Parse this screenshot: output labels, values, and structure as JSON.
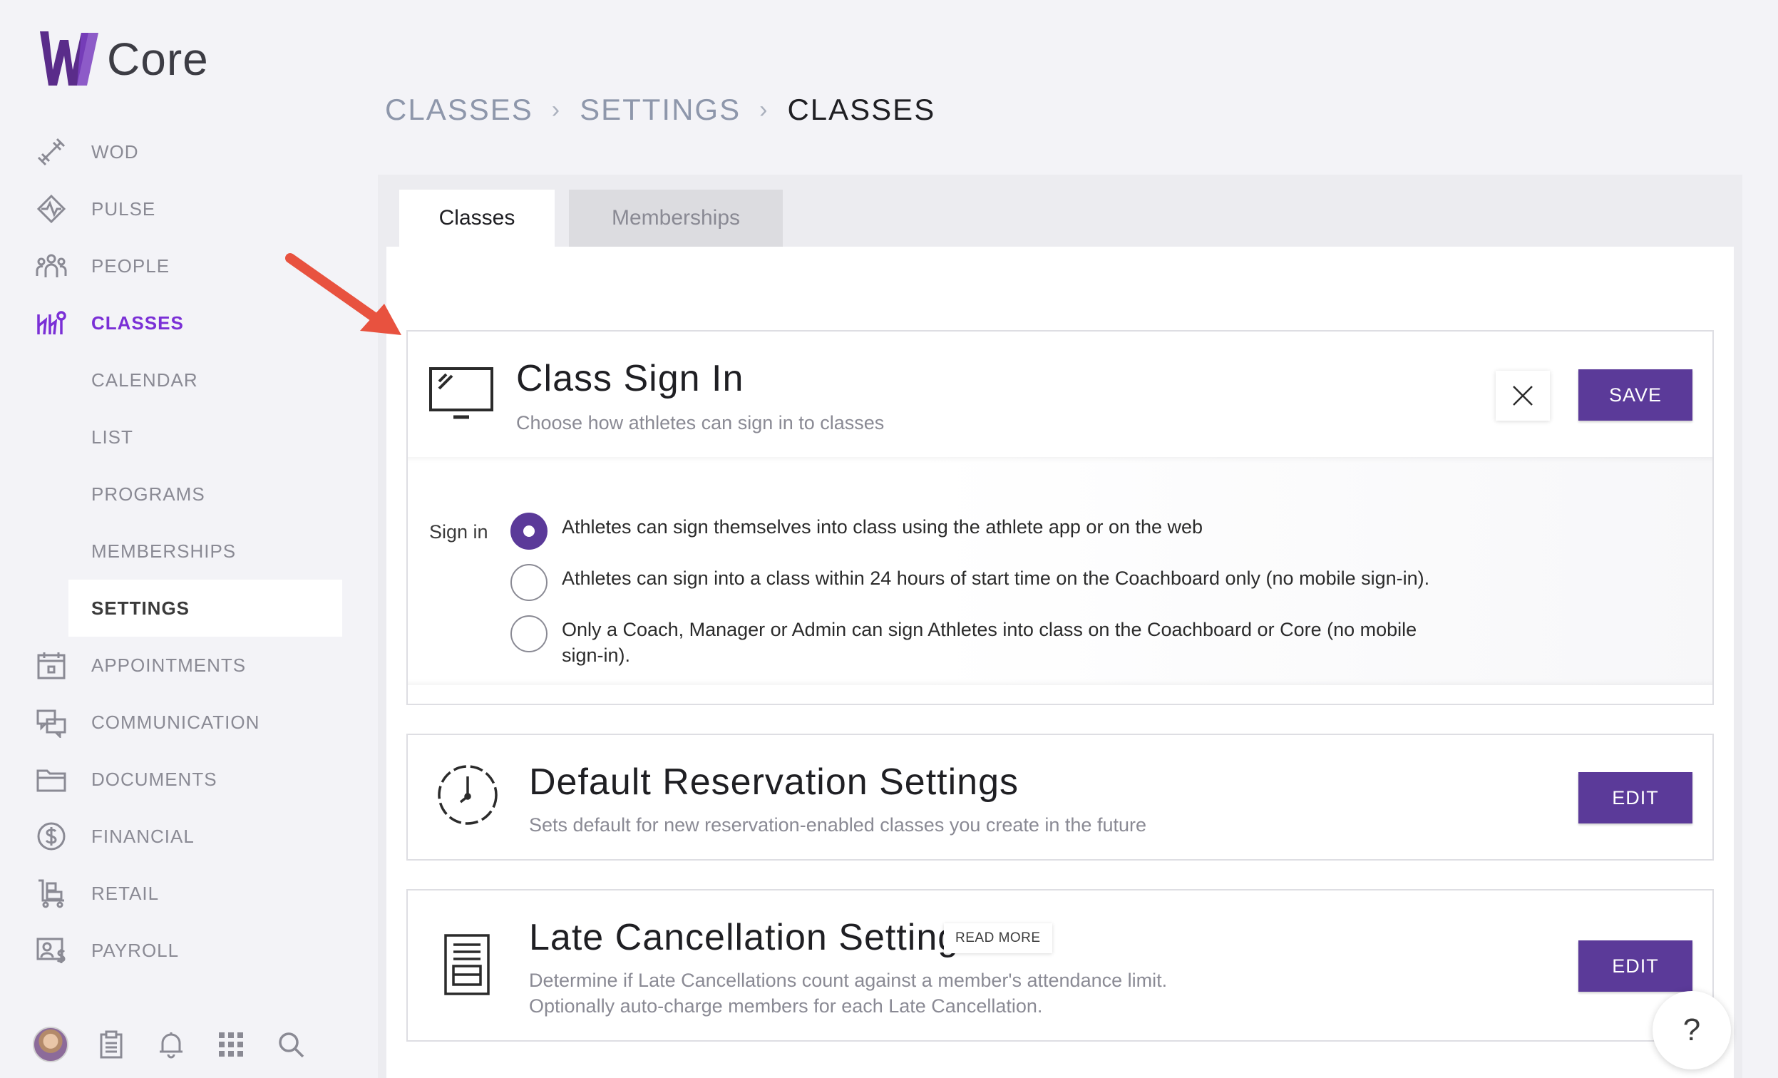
{
  "app": {
    "logo_text": "Core",
    "brand_color": "#5b3a99",
    "accent_color": "#7a2fd6"
  },
  "sidebar": {
    "items": [
      {
        "label": "WOD",
        "icon": "dumbbell-icon"
      },
      {
        "label": "PULSE",
        "icon": "pulse-icon"
      },
      {
        "label": "PEOPLE",
        "icon": "people-icon"
      },
      {
        "label": "CLASSES",
        "icon": "classes-icon",
        "active": true
      },
      {
        "label": "CALENDAR"
      },
      {
        "label": "LIST"
      },
      {
        "label": "PROGRAMS"
      },
      {
        "label": "MEMBERSHIPS"
      },
      {
        "label": "SETTINGS",
        "selected": true
      },
      {
        "label": "APPOINTMENTS",
        "icon": "calendar-icon"
      },
      {
        "label": "COMMUNICATION",
        "icon": "chat-icon"
      },
      {
        "label": "DOCUMENTS",
        "icon": "folder-icon"
      },
      {
        "label": "FINANCIAL",
        "icon": "dollar-icon"
      },
      {
        "label": "RETAIL",
        "icon": "cart-icon"
      },
      {
        "label": "PAYROLL",
        "icon": "payroll-icon"
      }
    ]
  },
  "breadcrumb": {
    "items": [
      "CLASSES",
      "SETTINGS",
      "CLASSES"
    ],
    "separator": "›"
  },
  "tabs": [
    {
      "label": "Classes"
    },
    {
      "label": "Memberships"
    }
  ],
  "class_sign_in": {
    "title": "Class Sign In",
    "subtitle": "Choose how athletes can sign in to classes",
    "save_label": "SAVE",
    "sign_in_label": "Sign in",
    "options": [
      {
        "text": "Athletes can sign themselves into class using the athlete app or on the web",
        "checked": true
      },
      {
        "text": "Athletes can sign into a class within 24 hours of start time on the Coachboard only (no mobile sign-in).",
        "checked": false
      },
      {
        "text": "Only a Coach, Manager or Admin can sign Athletes into class on the Coachboard or Core (no mobile sign-in).",
        "checked": false
      }
    ]
  },
  "default_reservation": {
    "title": "Default Reservation Settings",
    "subtitle": "Sets default for new reservation-enabled classes you create in the future",
    "edit_label": "EDIT"
  },
  "late_cancellation": {
    "title": "Late Cancellation Settings",
    "read_more": "READ MORE",
    "subtitle": "Determine if Late Cancellations count against a member's attendance limit. Optionally auto-charge members for each Late Cancellation.",
    "edit_label": "EDIT"
  },
  "help": {
    "label": "?"
  }
}
